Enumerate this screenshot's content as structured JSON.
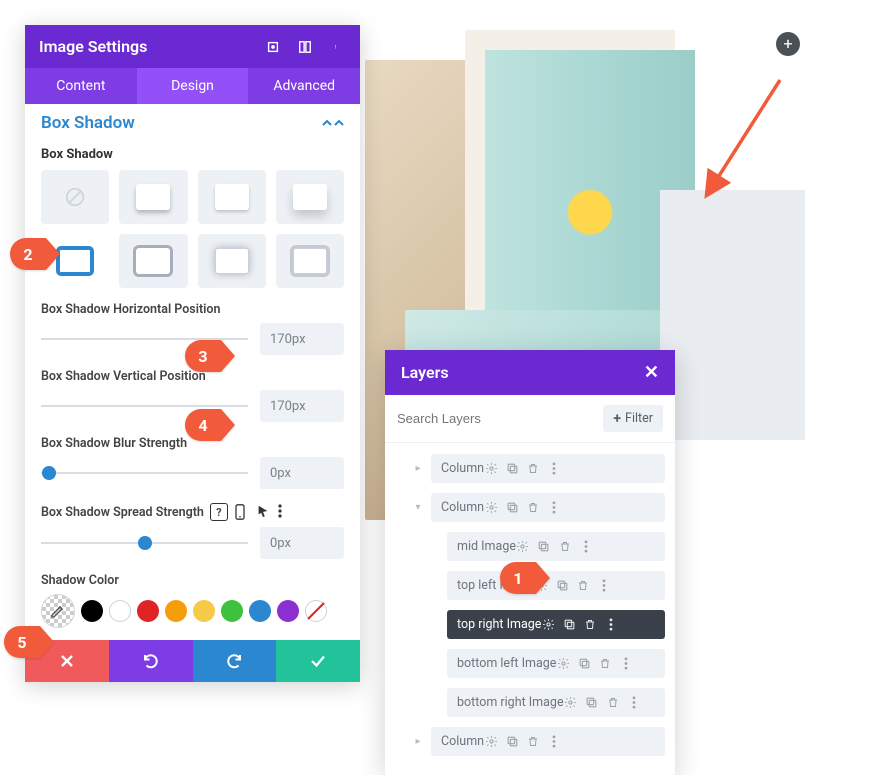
{
  "settings_panel": {
    "title": "Image Settings",
    "tabs": {
      "content": "Content",
      "design": "Design",
      "advanced": "Advanced",
      "active": "design"
    },
    "section_title": "Box Shadow",
    "box_shadow_label": "Box Shadow",
    "horizontal_label": "Box Shadow Horizontal Position",
    "horizontal_value": "170px",
    "vertical_label": "Box Shadow Vertical Position",
    "vertical_value": "170px",
    "blur_label": "Box Shadow Blur Strength",
    "blur_value": "0px",
    "spread_label": "Box Shadow Spread Strength",
    "spread_value": "0px",
    "shadow_color_label": "Shadow Color",
    "colors": [
      "#000000",
      "#ffffff",
      "#e02424",
      "#f59e0b",
      "#f7c948",
      "#3ec13e",
      "#2a87d0",
      "#8b2fd1"
    ]
  },
  "layers_panel": {
    "title": "Layers",
    "search_placeholder": "Search Layers",
    "filter_label": "Filter",
    "rows": [
      {
        "label": "Column",
        "indent": 1,
        "caret": "right",
        "active": false
      },
      {
        "label": "Column",
        "indent": 1,
        "caret": "down",
        "active": false
      },
      {
        "label": "mid Image",
        "indent": 2,
        "caret": "",
        "active": false
      },
      {
        "label": "top left Image",
        "indent": 2,
        "caret": "",
        "active": false
      },
      {
        "label": "top right Image",
        "indent": 2,
        "caret": "",
        "active": true
      },
      {
        "label": "bottom left Image",
        "indent": 2,
        "caret": "",
        "active": false
      },
      {
        "label": "bottom right Image",
        "indent": 2,
        "caret": "",
        "active": false
      },
      {
        "label": "Column",
        "indent": 1,
        "caret": "right",
        "active": false
      }
    ]
  },
  "callouts": {
    "1": "1",
    "2": "2",
    "3": "3",
    "4": "4",
    "5": "5"
  }
}
